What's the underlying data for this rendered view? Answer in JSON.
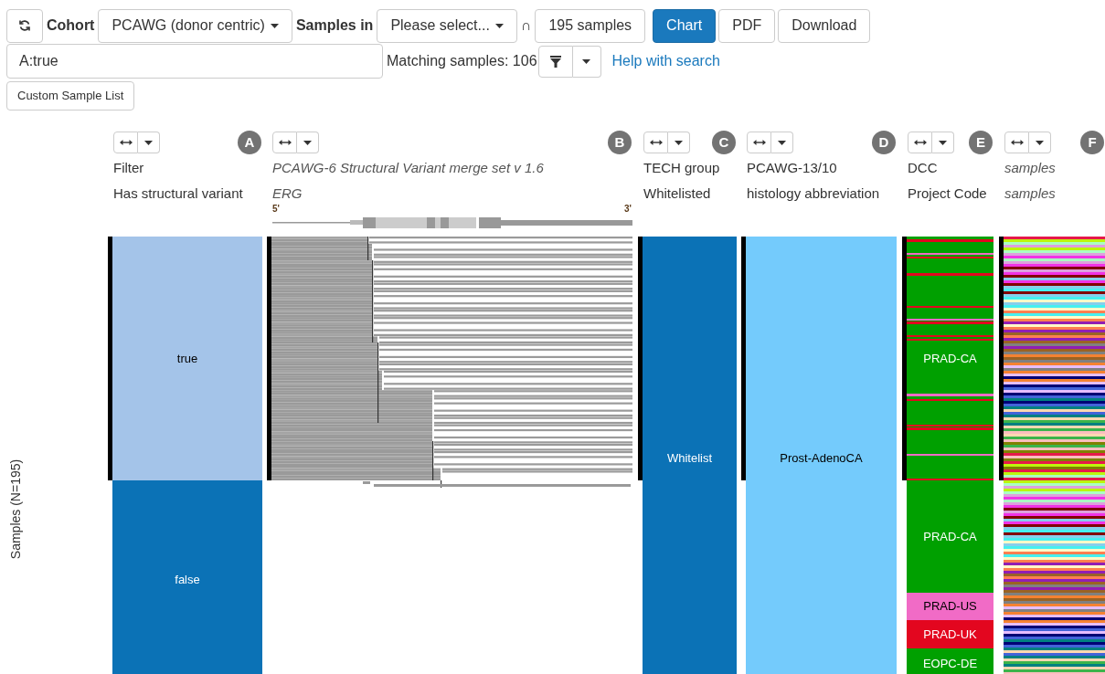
{
  "toolbar": {
    "cohort_label": "Cohort",
    "cohort": "PCAWG (donor centric)",
    "samples_in_label": "Samples in",
    "samples_in": "Please select...",
    "intersection": "∩",
    "sample_count": "195 samples",
    "views": [
      {
        "label": "Chart",
        "selected": true
      },
      {
        "label": "PDF",
        "selected": false
      },
      {
        "label": "Download",
        "selected": false
      }
    ]
  },
  "search": {
    "value": "A:true",
    "matching": "Matching samples: 106",
    "help": "Help with search"
  },
  "custom_sample_list": "Custom Sample List",
  "y_axis_label": "Samples (N=195)",
  "columns": [
    {
      "badge": "A",
      "kind": "categorical",
      "italic": false,
      "title": "Filter",
      "subtitle": "Has structural variant",
      "segments": [
        {
          "label": "true",
          "color": "#a4c4e9"
        },
        {
          "label": "false",
          "color": "#0b72b6"
        }
      ]
    },
    {
      "badge": "B",
      "kind": "structural_variant",
      "italic": true,
      "title": "PCAWG-6 Structural Variant merge set v 1.6",
      "subtitle": "ERG",
      "five_prime": "5'",
      "three_prime": "3'"
    },
    {
      "badge": "C",
      "kind": "categorical",
      "italic": false,
      "title": "TECH group",
      "subtitle": "Whitelisted",
      "segments": [
        {
          "label": "Whitelist",
          "color": "#0b72b6"
        }
      ]
    },
    {
      "badge": "D",
      "kind": "categorical",
      "italic": false,
      "title": "PCAWG-13/10",
      "subtitle": "histology abbreviation",
      "segments": [
        {
          "label": "Prost-AdenoCA",
          "color": "#74cbfc"
        }
      ]
    },
    {
      "badge": "E",
      "kind": "categorical",
      "italic": false,
      "title": "DCC",
      "subtitle": "Project Code",
      "segments": [
        {
          "label": "PRAD-CA",
          "color": "#00a000"
        },
        {
          "label": "PRAD-CA",
          "color": "#00a000"
        },
        {
          "label": "PRAD-US",
          "color": "#f16bc6"
        },
        {
          "label": "PRAD-UK",
          "color": "#e3061f"
        },
        {
          "label": "EOPC-DE",
          "color": "#00a000"
        }
      ]
    },
    {
      "badge": "F",
      "kind": "samples",
      "italic": true,
      "title": "samples",
      "subtitle": "samples"
    }
  ]
}
